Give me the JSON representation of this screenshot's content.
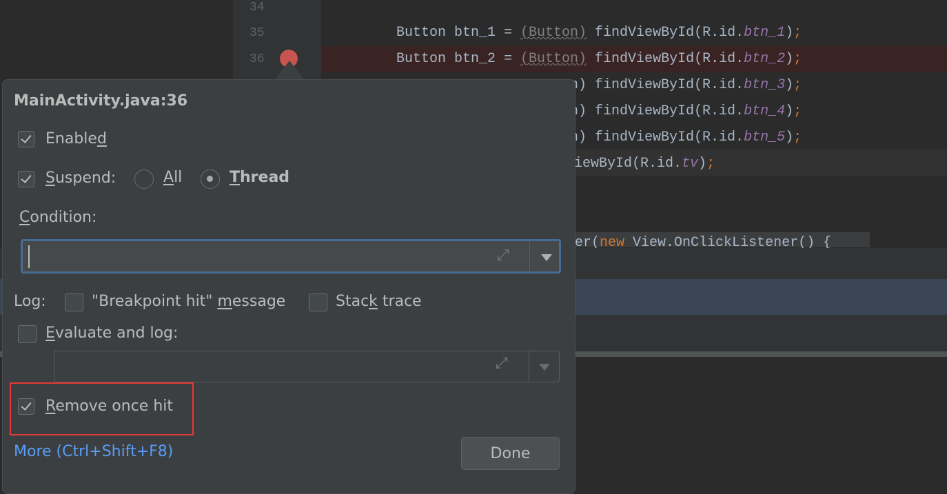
{
  "editor": {
    "line_numbers": [
      "34",
      "35",
      "36"
    ],
    "lines": [
      {
        "pre": "Button btn_1 = ",
        "cast": "(Button)",
        "mid": " findViewById(R.id.",
        "field": "btn_1",
        "close": ")",
        "semi": ";"
      },
      {
        "pre": "Button btn_2 = ",
        "cast": "(Button)",
        "mid": " findViewById(R.id.",
        "field": "btn_2",
        "close": ")",
        "semi": ";"
      }
    ],
    "partial_lines": [
      {
        "pre": "n)",
        "mid": " findViewById(R.id.",
        "field": "btn_3",
        "close": ")",
        "semi": ";"
      },
      {
        "pre": "n)",
        "mid": " findViewById(R.id.",
        "field": "btn_4",
        "close": ")",
        "semi": ";"
      },
      {
        "pre": "n)",
        "mid": " findViewById(R.id.",
        "field": "btn_5",
        "close": ")",
        "semi": ";"
      }
    ],
    "tv_line": {
      "pre": "iewById(R.id.",
      "field": "tv",
      "close": ")",
      "semi": ";"
    },
    "listener_line": {
      "pre": "ner(",
      "kw": "new",
      "post": " View.OnClickListener() {"
    },
    "breakpoint_color": "#c75450"
  },
  "popup": {
    "title": "MainActivity.java:36",
    "enabled": {
      "pre": "Enable",
      "mn": "d",
      "post": "",
      "checked": true
    },
    "suspend": {
      "pre": "",
      "mn": "S",
      "post": "uspend:",
      "checked": true
    },
    "suspend_all": {
      "pre": "",
      "mn": "A",
      "post": "ll",
      "selected": false
    },
    "suspend_thread": {
      "pre": "",
      "mn": "T",
      "post": "hread",
      "selected": true
    },
    "condition_label": {
      "pre": "",
      "mn": "C",
      "post": "ondition:"
    },
    "condition_value": "",
    "log_label": "Log:",
    "log_message": {
      "pre": "\"Breakpoint hit\" ",
      "mn": "m",
      "post": "essage",
      "checked": false
    },
    "stack_trace": {
      "pre": "Stac",
      "mn": "k",
      "post": " trace",
      "checked": false
    },
    "evaluate": {
      "pre": "",
      "mn": "E",
      "post": "valuate and log:",
      "checked": false
    },
    "evaluate_value": "",
    "remove_once_hit": {
      "pre": "",
      "mn": "R",
      "post": "emove once hit",
      "checked": true
    },
    "more_link": "More (Ctrl+Shift+F8)",
    "done_label": "Done",
    "highlight_color": "#e53935"
  }
}
